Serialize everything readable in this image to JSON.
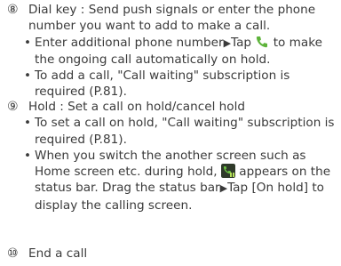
{
  "items": [
    {
      "number": "⑧",
      "title": "Dial key : Send push signals or enter the phone number you want to add to make a call.",
      "bullets": [
        {
          "before": "Enter additional phone number",
          "arrow": "▶",
          "middle": "Tap ",
          "icon": "green-handset-icon",
          "after": " to make the ongoing call automatically on hold."
        },
        {
          "text": "To add a call, \"Call waiting\" subscription is required (P.81)."
        }
      ]
    },
    {
      "number": "⑨",
      "title": "Hold : Set a call on hold/cancel hold",
      "bullets": [
        {
          "text": "To set a call on hold, \"Call waiting\" subscription is required (P.81)."
        },
        {
          "before": "When you switch the another screen such as Home screen etc. during hold, ",
          "icon": "call-on-hold-status-icon",
          "after": " appears on the status bar. Drag the status bar",
          "arrow": "▶",
          "end": "Tap [On hold] to display the calling screen."
        }
      ]
    },
    {
      "number": "⑩",
      "title": "End a call"
    }
  ],
  "colors": {
    "text": "#3a3a3a",
    "phone_green": "#5db33a",
    "status_dark": "#2f3a2a"
  }
}
